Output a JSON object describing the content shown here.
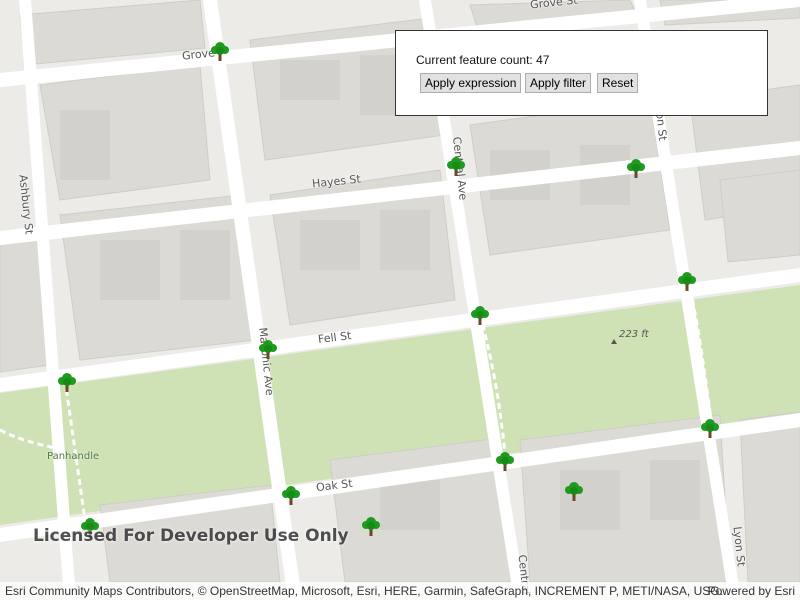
{
  "panel": {
    "count_label": "Current feature count:",
    "count_value": "47",
    "buttons": {
      "apply_expression": "Apply expression",
      "apply_filter": "Apply filter",
      "reset": "Reset"
    }
  },
  "map": {
    "streets": {
      "grove_upper": "Grove St",
      "grove_left": "Grove",
      "hayes": "Hayes St",
      "fell": "Fell St",
      "oak": "Oak St",
      "ashbury": "Ashbury St",
      "masonic": "Masonic Ave",
      "central_upper": "Central Ave",
      "central_lower": "Central",
      "lyon_upper": "on St",
      "lyon_lower": "Lyon St"
    },
    "park_label": "Panhandle",
    "elevation_label": "223 ft",
    "tree_icon": "tree-icon",
    "colors": {
      "park": "#cfe2b5",
      "road": "#ffffff",
      "block": "#dcdad5",
      "tree": "#1e9a1e"
    }
  },
  "watermark": "Licensed For Developer Use Only",
  "attribution": {
    "text": "Esri Community Maps Contributors, © OpenStreetMap, Microsoft, Esri, HERE, Garmin, SafeGraph, INCREMENT P, METI/NASA, USG...",
    "powered_by": "Powered by Esri"
  }
}
